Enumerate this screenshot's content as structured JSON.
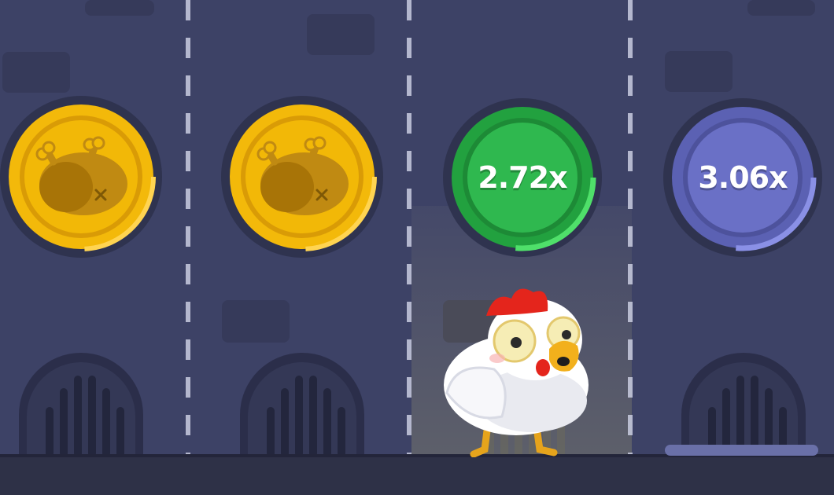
{
  "game": {
    "lanes": [
      {
        "state": "passed",
        "icon": "roasted-chicken-icon"
      },
      {
        "state": "passed",
        "icon": "roasted-chicken-icon"
      },
      {
        "state": "current",
        "multiplier": "2.72x"
      },
      {
        "state": "next",
        "multiplier": "3.06x"
      }
    ],
    "player": {
      "icon": "chicken-icon"
    }
  },
  "colors": {
    "background": "#3d4266",
    "gold_coin": "#f2b807",
    "current_coin": "#2fb84f",
    "next_coin": "#6a70c6",
    "ground": "#2e3147"
  }
}
